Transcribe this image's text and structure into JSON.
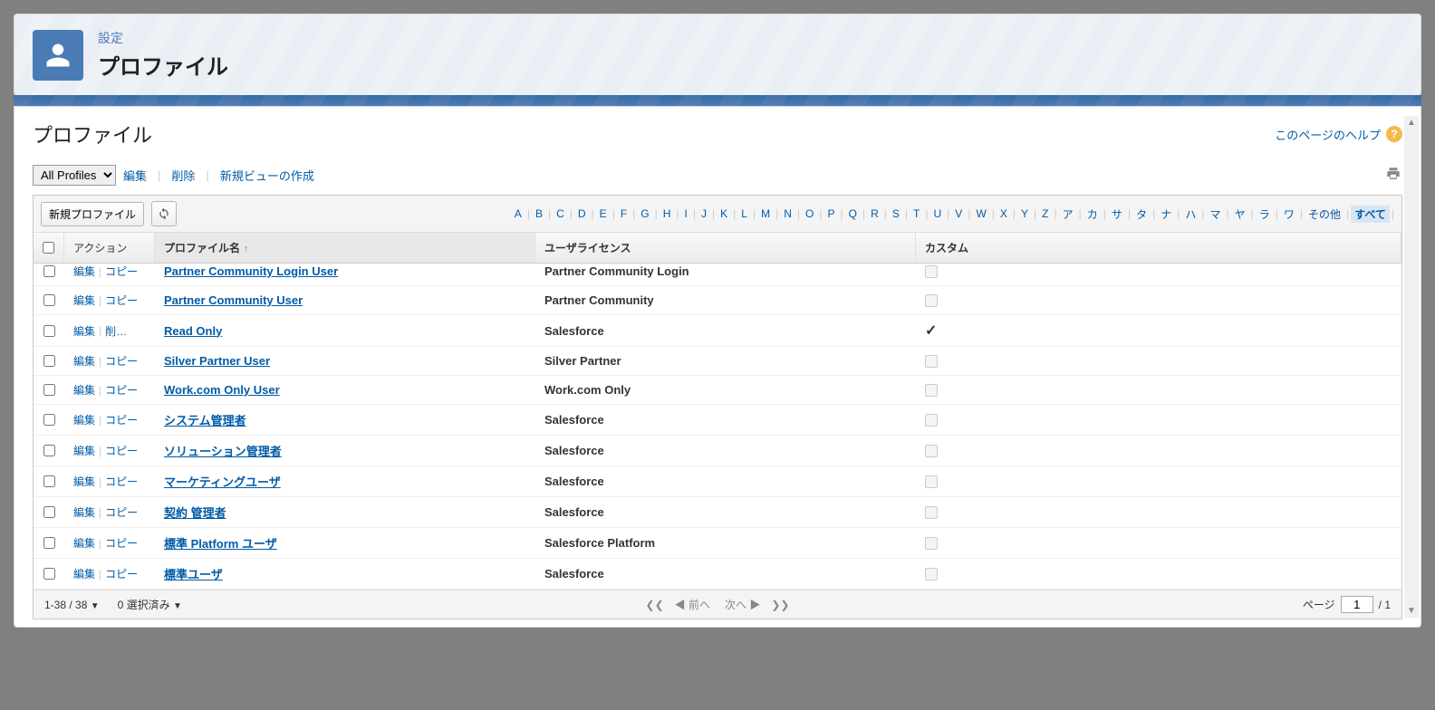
{
  "header": {
    "sub": "設定",
    "title": "プロファイル"
  },
  "page": {
    "title": "プロファイル",
    "helpText": "このページのヘルプ"
  },
  "view": {
    "selected": "All Profiles",
    "editLink": "編集",
    "deleteLink": "削除",
    "newViewLink": "新規ビューの作成"
  },
  "toolbar": {
    "newProfile": "新規プロファイル"
  },
  "alpha": {
    "letters": [
      "A",
      "B",
      "C",
      "D",
      "E",
      "F",
      "G",
      "H",
      "I",
      "J",
      "K",
      "L",
      "M",
      "N",
      "O",
      "P",
      "Q",
      "R",
      "S",
      "T",
      "U",
      "V",
      "W",
      "X",
      "Y",
      "Z",
      "ア",
      "カ",
      "サ",
      "タ",
      "ナ",
      "ハ",
      "マ",
      "ヤ",
      "ラ",
      "ワ"
    ],
    "other": "その他",
    "all": "すべて"
  },
  "columns": {
    "action": "アクション",
    "name": "プロファイル名",
    "license": "ユーザライセンス",
    "custom": "カスタム"
  },
  "actions": {
    "edit": "編集",
    "copy": "コピー",
    "del": "削…"
  },
  "rows": [
    {
      "name": "Partner Community Login User",
      "license": "Partner Community Login",
      "custom": false,
      "act2": "copy"
    },
    {
      "name": "Partner Community User",
      "license": "Partner Community",
      "custom": false,
      "act2": "copy"
    },
    {
      "name": "Read Only",
      "license": "Salesforce",
      "custom": true,
      "act2": "del"
    },
    {
      "name": "Silver Partner User",
      "license": "Silver Partner",
      "custom": false,
      "act2": "copy"
    },
    {
      "name": "Work.com Only User",
      "license": "Work.com Only",
      "custom": false,
      "act2": "copy"
    },
    {
      "name": "システム管理者",
      "license": "Salesforce",
      "custom": false,
      "act2": "copy"
    },
    {
      "name": "ソリューション管理者",
      "license": "Salesforce",
      "custom": false,
      "act2": "copy"
    },
    {
      "name": "マーケティングユーザ",
      "license": "Salesforce",
      "custom": false,
      "act2": "copy"
    },
    {
      "name": "契約 管理者",
      "license": "Salesforce",
      "custom": false,
      "act2": "copy"
    },
    {
      "name": "標準 Platform ユーザ",
      "license": "Salesforce Platform",
      "custom": false,
      "act2": "copy"
    },
    {
      "name": "標準ユーザ",
      "license": "Salesforce",
      "custom": false,
      "act2": "copy"
    }
  ],
  "footer": {
    "range": "1-38 / 38",
    "selected": "0 選択済み",
    "prev": "前へ",
    "next": "次へ",
    "pageLabel": "ページ",
    "pageValue": "1",
    "pageTotal": "/ 1"
  }
}
